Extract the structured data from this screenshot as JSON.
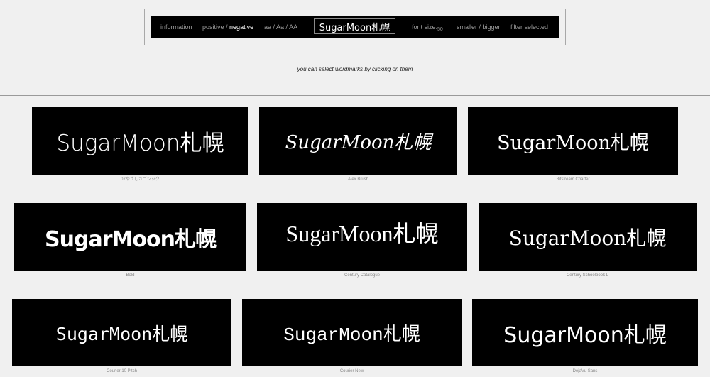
{
  "toolbar": {
    "information": "information",
    "positive": "positive /",
    "negative": "negative",
    "case_lower": "aa /",
    "case_title": "Aa /",
    "case_upper": "AA",
    "sample_text": "SugarMoon札幌",
    "font_size_label": "font size:",
    "font_size_value": "50",
    "smaller": "smaller /",
    "bigger": "bigger",
    "filter_selected": "filter selected"
  },
  "hint": "you can select wordmarks by clicking on them",
  "wordmarks": [
    {
      "text": "SugarMoon札幌",
      "font": "07やさしさゴシック"
    },
    {
      "text": "SugarMoon札幌",
      "font": "Alex Brush"
    },
    {
      "text": "SugarMoon札幌",
      "font": "Bitstream Charter"
    },
    {
      "text": "SugarMoon札幌",
      "font": "Bold"
    },
    {
      "text": "SugarMoon札幌",
      "font": "Century Catalogue"
    },
    {
      "text": "SugarMoon札幌",
      "font": "Century Schoolbook L"
    },
    {
      "text": "SugarMoon札幌",
      "font": "Courier 10 Pitch"
    },
    {
      "text": "SugarMoon札幌",
      "font": "Courier New"
    },
    {
      "text": "SugarMoon札幌",
      "font": "DejaVu Sans"
    }
  ]
}
